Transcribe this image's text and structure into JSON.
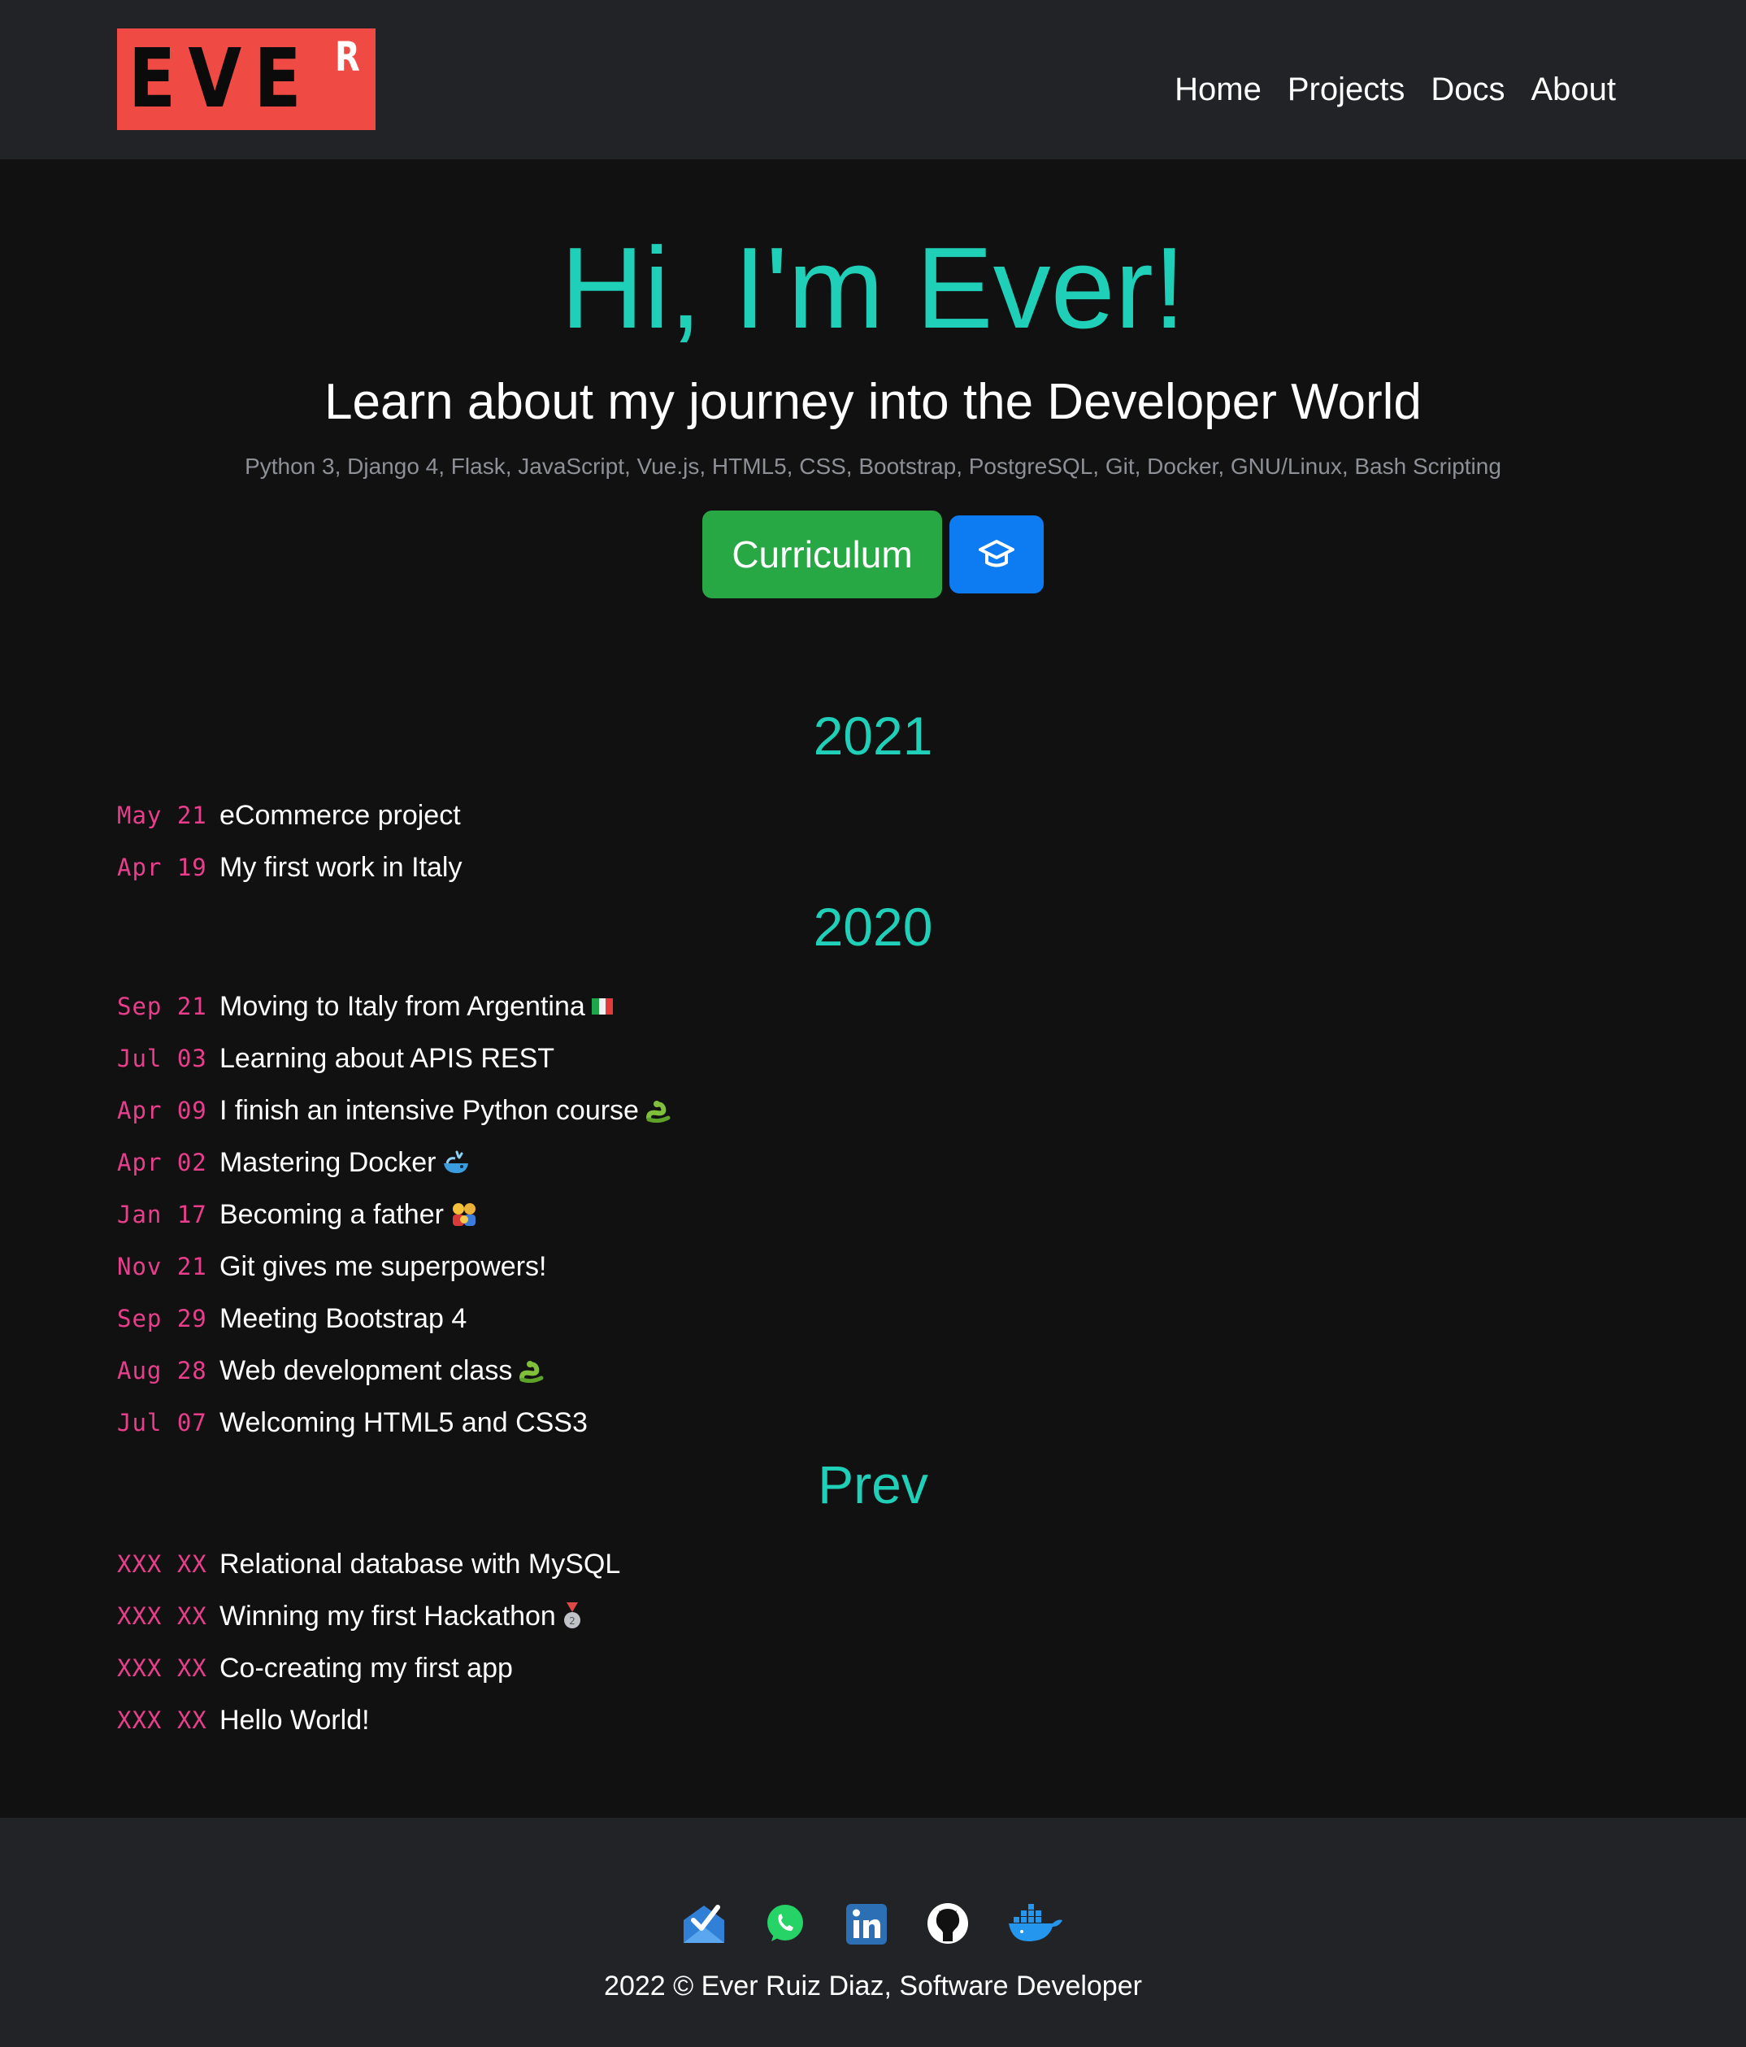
{
  "logo": {
    "text": "EVE",
    "superscript": "R"
  },
  "nav": {
    "links": [
      {
        "label": "Home"
      },
      {
        "label": "Projects"
      },
      {
        "label": "Docs"
      },
      {
        "label": "About"
      }
    ]
  },
  "hero": {
    "title": "Hi, I'm Ever!",
    "subtitle": "Learn about my journey into the Developer World",
    "tech": "Python 3, Django 4, Flask, JavaScript, Vue.js, HTML5, CSS, Bootstrap, PostgreSQL, Git, Docker, GNU/Linux, Bash Scripting",
    "curriculum_button": "Curriculum",
    "graduation_icon": "graduation-cap-icon"
  },
  "timeline": [
    {
      "year": "2021",
      "entries": [
        {
          "date": "May 21",
          "title": "eCommerce project",
          "emoji": ""
        },
        {
          "date": "Apr 19",
          "title": "My first work in Italy",
          "emoji": ""
        }
      ]
    },
    {
      "year": "2020",
      "entries": [
        {
          "date": "Sep 21",
          "title": "Moving to Italy from Argentina",
          "emoji": "italy-flag"
        },
        {
          "date": "Jul 03",
          "title": "Learning about APIS REST",
          "emoji": ""
        },
        {
          "date": "Apr 09",
          "title": "I finish an intensive Python course",
          "emoji": "snake"
        },
        {
          "date": "Apr 02",
          "title": "Mastering Docker",
          "emoji": "whale"
        },
        {
          "date": "Jan 17",
          "title": "Becoming a father",
          "emoji": "family"
        },
        {
          "date": "Nov 21",
          "title": "Git gives me superpowers!",
          "emoji": ""
        },
        {
          "date": "Sep 29",
          "title": "Meeting Bootstrap 4",
          "emoji": ""
        },
        {
          "date": "Aug 28",
          "title": "Web development class",
          "emoji": "snake"
        },
        {
          "date": "Jul 07",
          "title": "Welcoming HTML5 and CSS3",
          "emoji": ""
        }
      ]
    },
    {
      "year": "Prev",
      "entries": [
        {
          "date": "XXX XX",
          "title": "Relational database with MySQL",
          "emoji": ""
        },
        {
          "date": "XXX XX",
          "title": "Winning my first Hackathon",
          "emoji": "medal"
        },
        {
          "date": "XXX XX",
          "title": "Co-creating my first app",
          "emoji": ""
        },
        {
          "date": "XXX XX",
          "title": "Hello World!",
          "emoji": ""
        }
      ]
    }
  ],
  "footer": {
    "social": [
      {
        "name": "email-icon"
      },
      {
        "name": "whatsapp-icon"
      },
      {
        "name": "linkedin-icon"
      },
      {
        "name": "github-icon"
      },
      {
        "name": "docker-icon"
      }
    ],
    "copyright": "2022 © Ever Ruiz Diaz, Software Developer"
  },
  "colors": {
    "accent": "#1fcfb8",
    "date": "#e83e8c",
    "curriculum": "#28a745",
    "icon_button": "#0d7cf2",
    "logo_bg": "#f04a45"
  }
}
